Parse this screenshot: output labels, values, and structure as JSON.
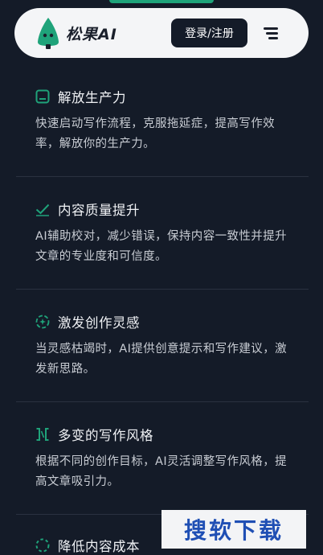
{
  "header": {
    "brand": "松果AI",
    "login_label": "登录/注册",
    "icons": {
      "logo": "pine-tree-logo-icon",
      "menu": "hamburger-menu-icon"
    }
  },
  "colors": {
    "background": "#141b28",
    "accent": "#1fa37a",
    "navbar": "#f4f5f7"
  },
  "features": [
    {
      "icon": "window-icon",
      "title": "解放生产力",
      "desc": "快速启动写作流程，克服拖延症，提高写作效率，解放你的生产力。"
    },
    {
      "icon": "check-icon",
      "title": "内容质量提升",
      "desc": "AI辅助校对，减少错误，保持内容一致性并提升文章的专业度和可信度。"
    },
    {
      "icon": "sparkle-target-icon",
      "title": "激发创作灵感",
      "desc": "当灵感枯竭时，AI提供创意提示和写作建议，激发新思路。"
    },
    {
      "icon": "style-brackets-icon",
      "title": "多变的写作风格",
      "desc": "根据不同的创作目标，AI灵活调整写作风格，提高文章吸引力。"
    },
    {
      "icon": "dashed-circle-icon",
      "title": "降低内容成本",
      "desc": ""
    }
  ],
  "watermark": {
    "text": "搜软下载"
  }
}
